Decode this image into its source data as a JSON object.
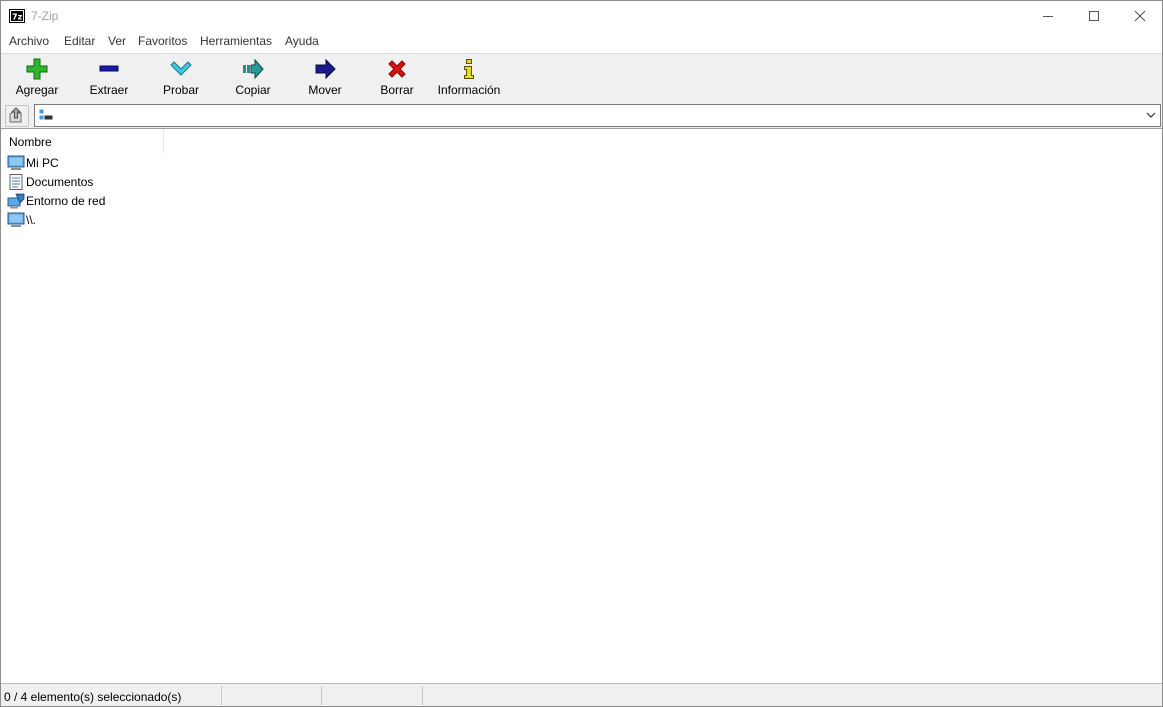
{
  "window": {
    "title": "7-Zip",
    "icon": "7z-logo-icon"
  },
  "menu": {
    "items": [
      "Archivo",
      "Editar",
      "Ver",
      "Favoritos",
      "Herramientas",
      "Ayuda"
    ]
  },
  "toolbar": {
    "buttons": [
      {
        "label": "Agregar",
        "icon": "add-plus-icon",
        "color": "#2db52d"
      },
      {
        "label": "Extraer",
        "icon": "extract-minus-icon",
        "color": "#1a1aa8"
      },
      {
        "label": "Probar",
        "icon": "test-check-icon",
        "color": "#28b4c8"
      },
      {
        "label": "Copiar",
        "icon": "copy-arrow-icon",
        "color": "#2a8a8a"
      },
      {
        "label": "Mover",
        "icon": "move-arrow-icon",
        "color": "#1a1a8a"
      },
      {
        "label": "Borrar",
        "icon": "delete-x-icon",
        "color": "#e01010"
      },
      {
        "label": "Información",
        "icon": "info-icon",
        "color": "#d8c818"
      }
    ]
  },
  "address": {
    "value": "",
    "icon": "computer-drive-icon"
  },
  "list": {
    "column_header": "Nombre",
    "rows": [
      {
        "label": "Mi PC",
        "icon": "computer-icon"
      },
      {
        "label": "Documentos",
        "icon": "documents-icon"
      },
      {
        "label": "Entorno de red",
        "icon": "network-icon"
      },
      {
        "label": "\\\\.",
        "icon": "computer-icon"
      }
    ]
  },
  "status": {
    "text": "0 / 4 elemento(s) seleccionado(s)"
  }
}
